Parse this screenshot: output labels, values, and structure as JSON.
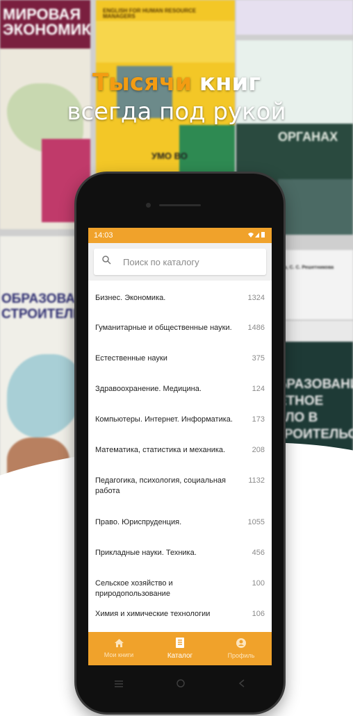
{
  "headline": {
    "accent": "Тысячи",
    "rest": "книг",
    "line2": "всегда под рукой"
  },
  "status_bar": {
    "time": "14:03",
    "icons": "wifi-signal-battery-icons"
  },
  "search": {
    "placeholder": "Поиск по каталогу",
    "icon": "search-icon"
  },
  "catalog": [
    {
      "name": "Бизнес. Экономика.",
      "count": "1324"
    },
    {
      "name": "Гуманитарные и общественные науки.",
      "count": "1486"
    },
    {
      "name": "Естественные науки",
      "count": "375"
    },
    {
      "name": "Здравоохранение. Медицина.",
      "count": "124"
    },
    {
      "name": "Компьютеры. Интернет. Информатика.",
      "count": "173"
    },
    {
      "name": "Математика, статистика и механика.",
      "count": "208"
    },
    {
      "name": "Педагогика, психология, социальная работа",
      "count": "1132"
    },
    {
      "name": "Право. Юриспруденция.",
      "count": "1055"
    },
    {
      "name": "Прикладные науки. Техника.",
      "count": "456"
    },
    {
      "name": "Сельское хозяйство и природопользование",
      "count": "100"
    },
    {
      "name": "Химия и химические технологии",
      "count": "106"
    }
  ],
  "tabs": [
    {
      "label": "Мои книги",
      "icon": "home-icon",
      "active": false
    },
    {
      "label": "Каталог",
      "icon": "book-icon",
      "active": true
    },
    {
      "label": "Профиль",
      "icon": "user-icon",
      "active": false
    }
  ],
  "covers": {
    "c1": "МИРОВАЯ ЭКОНОМИКА",
    "c2": "ENGLISH FOR HUMAN RESOURCE MANAGERS",
    "c2b": "УМО ВО",
    "c4": "ОРГАНАХ",
    "c5": "ОБРАЗОВАНИЕ СТРОИТЕЛЬСТВЕ",
    "c6": "Лузина, С. С. Решетникова",
    "c7": "ОБРАЗОВАНИ МЕТНОЕ ДЕЛО В СТРОИТЕЛЬСТВЕ"
  },
  "colors": {
    "brand": "#f0a22b",
    "accent": "#f39c12"
  }
}
